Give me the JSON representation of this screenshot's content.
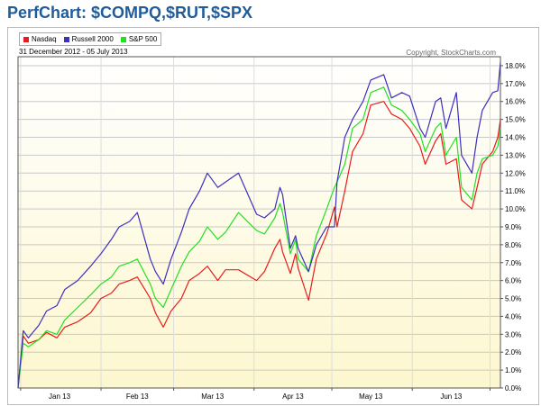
{
  "header": {
    "title": "PerfChart: $COMPQ,$RUT,$SPX"
  },
  "chart_data": {
    "type": "line",
    "title": "PerfChart: $COMPQ,$RUT,$SPX",
    "date_range": "31 December 2012 - 05 July 2013",
    "copyright": "Copyright, StockCharts.com",
    "x_tick_labels": [
      "Jan 13",
      "Feb 13",
      "Mar 13",
      "Apr 13",
      "May 13",
      "Jun 13"
    ],
    "y_tick_labels": [
      "0.0%",
      "1.0%",
      "2.0%",
      "3.0%",
      "4.0%",
      "5.0%",
      "6.0%",
      "7.0%",
      "8.0%",
      "9.0%",
      "10.0%",
      "11.0%",
      "12.0%",
      "13.0%",
      "14.0%",
      "15.0%",
      "16.0%",
      "17.0%",
      "18.0%"
    ],
    "ylim": [
      0,
      18.5
    ],
    "y_unit": "%",
    "legend_placement": "top-left",
    "grid": true,
    "series": [
      {
        "name": "Nasdaq",
        "color": "#e81c1c",
        "points": [
          [
            "2012-12-31",
            0
          ],
          [
            "2013-01-02",
            2.9
          ],
          [
            "2013-01-04",
            2.5
          ],
          [
            "2013-01-08",
            2.7
          ],
          [
            "2013-01-11",
            3.1
          ],
          [
            "2013-01-15",
            2.8
          ],
          [
            "2013-01-18",
            3.4
          ],
          [
            "2013-01-23",
            3.7
          ],
          [
            "2013-01-28",
            4.2
          ],
          [
            "2013-02-01",
            5.0
          ],
          [
            "2013-02-05",
            5.3
          ],
          [
            "2013-02-08",
            5.8
          ],
          [
            "2013-02-12",
            6.0
          ],
          [
            "2013-02-15",
            6.2
          ],
          [
            "2013-02-20",
            5.0
          ],
          [
            "2013-02-22",
            4.2
          ],
          [
            "2013-02-25",
            3.4
          ],
          [
            "2013-02-28",
            4.3
          ],
          [
            "2013-03-04",
            5.0
          ],
          [
            "2013-03-07",
            6.0
          ],
          [
            "2013-03-11",
            6.4
          ],
          [
            "2013-03-14",
            6.8
          ],
          [
            "2013-03-18",
            6.0
          ],
          [
            "2013-03-21",
            6.6
          ],
          [
            "2013-03-26",
            6.6
          ],
          [
            "2013-04-02",
            6.0
          ],
          [
            "2013-04-05",
            6.5
          ],
          [
            "2013-04-09",
            7.8
          ],
          [
            "2013-04-11",
            8.3
          ],
          [
            "2013-04-12",
            7.6
          ],
          [
            "2013-04-15",
            6.4
          ],
          [
            "2013-04-17",
            7.5
          ],
          [
            "2013-04-18",
            6.7
          ],
          [
            "2013-04-22",
            4.9
          ],
          [
            "2013-04-25",
            7.2
          ],
          [
            "2013-04-29",
            8.6
          ],
          [
            "2013-05-02",
            10.1
          ],
          [
            "2013-05-03",
            9.0
          ],
          [
            "2013-05-06",
            11.0
          ],
          [
            "2013-05-09",
            13.2
          ],
          [
            "2013-05-13",
            14.2
          ],
          [
            "2013-05-16",
            15.8
          ],
          [
            "2013-05-21",
            16.0
          ],
          [
            "2013-05-24",
            15.3
          ],
          [
            "2013-05-28",
            15.0
          ],
          [
            "2013-05-31",
            14.5
          ],
          [
            "2013-06-04",
            13.5
          ],
          [
            "2013-06-06",
            12.5
          ],
          [
            "2013-06-10",
            13.8
          ],
          [
            "2013-06-12",
            14.2
          ],
          [
            "2013-06-14",
            12.5
          ],
          [
            "2013-06-18",
            12.8
          ],
          [
            "2013-06-20",
            10.5
          ],
          [
            "2013-06-24",
            10.0
          ],
          [
            "2013-06-26",
            11.2
          ],
          [
            "2013-06-28",
            12.5
          ],
          [
            "2013-07-02",
            13.2
          ],
          [
            "2013-07-04",
            14.0
          ],
          [
            "2013-07-05",
            15.0
          ]
        ]
      },
      {
        "name": "Russell 2000",
        "color": "#3d2fbf",
        "points": [
          [
            "2012-12-31",
            0
          ],
          [
            "2013-01-02",
            3.2
          ],
          [
            "2013-01-04",
            2.8
          ],
          [
            "2013-01-08",
            3.5
          ],
          [
            "2013-01-11",
            4.3
          ],
          [
            "2013-01-15",
            4.6
          ],
          [
            "2013-01-18",
            5.5
          ],
          [
            "2013-01-23",
            6.0
          ],
          [
            "2013-01-28",
            6.8
          ],
          [
            "2013-02-01",
            7.5
          ],
          [
            "2013-02-05",
            8.3
          ],
          [
            "2013-02-08",
            9.0
          ],
          [
            "2013-02-12",
            9.3
          ],
          [
            "2013-02-15",
            9.8
          ],
          [
            "2013-02-20",
            7.2
          ],
          [
            "2013-02-22",
            6.5
          ],
          [
            "2013-02-25",
            5.8
          ],
          [
            "2013-02-28",
            7.2
          ],
          [
            "2013-03-04",
            8.7
          ],
          [
            "2013-03-07",
            10.0
          ],
          [
            "2013-03-11",
            11.0
          ],
          [
            "2013-03-14",
            12.0
          ],
          [
            "2013-03-18",
            11.2
          ],
          [
            "2013-03-21",
            11.5
          ],
          [
            "2013-03-26",
            12.0
          ],
          [
            "2013-04-02",
            9.7
          ],
          [
            "2013-04-05",
            9.5
          ],
          [
            "2013-04-09",
            10.0
          ],
          [
            "2013-04-11",
            11.2
          ],
          [
            "2013-04-12",
            10.8
          ],
          [
            "2013-04-15",
            7.8
          ],
          [
            "2013-04-17",
            8.5
          ],
          [
            "2013-04-18",
            7.8
          ],
          [
            "2013-04-22",
            6.5
          ],
          [
            "2013-04-25",
            8.0
          ],
          [
            "2013-04-29",
            9.0
          ],
          [
            "2013-05-02",
            9.0
          ],
          [
            "2013-05-03",
            11.5
          ],
          [
            "2013-05-06",
            14.0
          ],
          [
            "2013-05-09",
            15.0
          ],
          [
            "2013-05-13",
            16.0
          ],
          [
            "2013-05-16",
            17.2
          ],
          [
            "2013-05-21",
            17.5
          ],
          [
            "2013-05-24",
            16.2
          ],
          [
            "2013-05-28",
            16.5
          ],
          [
            "2013-05-31",
            16.3
          ],
          [
            "2013-06-04",
            14.5
          ],
          [
            "2013-06-06",
            14.0
          ],
          [
            "2013-06-10",
            16.0
          ],
          [
            "2013-06-12",
            16.2
          ],
          [
            "2013-06-14",
            14.5
          ],
          [
            "2013-06-18",
            16.5
          ],
          [
            "2013-06-20",
            13.0
          ],
          [
            "2013-06-24",
            12.0
          ],
          [
            "2013-06-26",
            14.0
          ],
          [
            "2013-06-28",
            15.5
          ],
          [
            "2013-07-02",
            16.5
          ],
          [
            "2013-07-04",
            16.6
          ],
          [
            "2013-07-05",
            18.2
          ]
        ]
      },
      {
        "name": "S&P 500",
        "color": "#24e024",
        "points": [
          [
            "2012-12-31",
            0
          ],
          [
            "2013-01-02",
            2.5
          ],
          [
            "2013-01-04",
            2.3
          ],
          [
            "2013-01-08",
            2.7
          ],
          [
            "2013-01-11",
            3.2
          ],
          [
            "2013-01-15",
            3.0
          ],
          [
            "2013-01-18",
            3.8
          ],
          [
            "2013-01-23",
            4.5
          ],
          [
            "2013-01-28",
            5.2
          ],
          [
            "2013-02-01",
            5.8
          ],
          [
            "2013-02-05",
            6.2
          ],
          [
            "2013-02-08",
            6.8
          ],
          [
            "2013-02-12",
            7.0
          ],
          [
            "2013-02-15",
            7.2
          ],
          [
            "2013-02-20",
            5.8
          ],
          [
            "2013-02-22",
            5.0
          ],
          [
            "2013-02-25",
            4.5
          ],
          [
            "2013-02-28",
            5.5
          ],
          [
            "2013-03-04",
            6.8
          ],
          [
            "2013-03-07",
            7.6
          ],
          [
            "2013-03-11",
            8.2
          ],
          [
            "2013-03-14",
            9.0
          ],
          [
            "2013-03-18",
            8.3
          ],
          [
            "2013-03-21",
            8.7
          ],
          [
            "2013-03-26",
            9.8
          ],
          [
            "2013-04-02",
            8.8
          ],
          [
            "2013-04-05",
            8.6
          ],
          [
            "2013-04-09",
            9.5
          ],
          [
            "2013-04-11",
            10.3
          ],
          [
            "2013-04-12",
            9.8
          ],
          [
            "2013-04-15",
            7.5
          ],
          [
            "2013-04-17",
            8.3
          ],
          [
            "2013-04-18",
            7.2
          ],
          [
            "2013-04-22",
            6.5
          ],
          [
            "2013-04-25",
            8.5
          ],
          [
            "2013-04-29",
            10.0
          ],
          [
            "2013-05-02",
            11.2
          ],
          [
            "2013-05-03",
            11.5
          ],
          [
            "2013-05-06",
            12.5
          ],
          [
            "2013-05-09",
            14.5
          ],
          [
            "2013-05-13",
            15.0
          ],
          [
            "2013-05-16",
            16.5
          ],
          [
            "2013-05-21",
            16.8
          ],
          [
            "2013-05-24",
            15.8
          ],
          [
            "2013-05-28",
            15.5
          ],
          [
            "2013-05-31",
            15.0
          ],
          [
            "2013-06-04",
            14.2
          ],
          [
            "2013-06-06",
            13.2
          ],
          [
            "2013-06-10",
            14.5
          ],
          [
            "2013-06-12",
            14.8
          ],
          [
            "2013-06-14",
            13.0
          ],
          [
            "2013-06-18",
            14.0
          ],
          [
            "2013-06-20",
            11.2
          ],
          [
            "2013-06-24",
            10.5
          ],
          [
            "2013-06-26",
            12.0
          ],
          [
            "2013-06-28",
            12.8
          ],
          [
            "2013-07-02",
            13.0
          ],
          [
            "2013-07-04",
            13.5
          ],
          [
            "2013-07-05",
            14.5
          ]
        ]
      }
    ]
  }
}
